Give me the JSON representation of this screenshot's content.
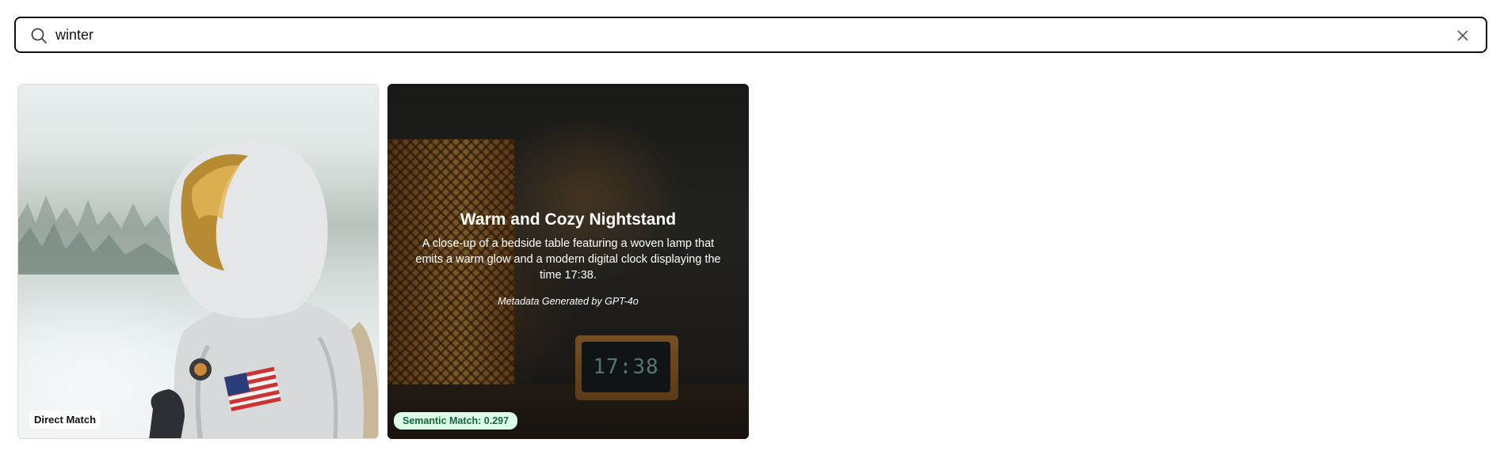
{
  "search": {
    "value": "winter",
    "icon": "search-icon",
    "clear_icon": "close-icon"
  },
  "results": [
    {
      "image": "astronaut in snowy forest",
      "badge": "Direct Match"
    },
    {
      "image": "bedside table with woven lamp and digital clock",
      "title": "Warm and Cozy Nightstand",
      "description": "A close-up of a bedside table featuring a woven lamp that emits a warm glow and a modern digital clock displaying the time 17:38.",
      "meta": "Metadata Generated by GPT-4o",
      "clock_text": "17:38",
      "badge": "Semantic Match: 0.297",
      "badge_color": "#dcfce7"
    }
  ]
}
